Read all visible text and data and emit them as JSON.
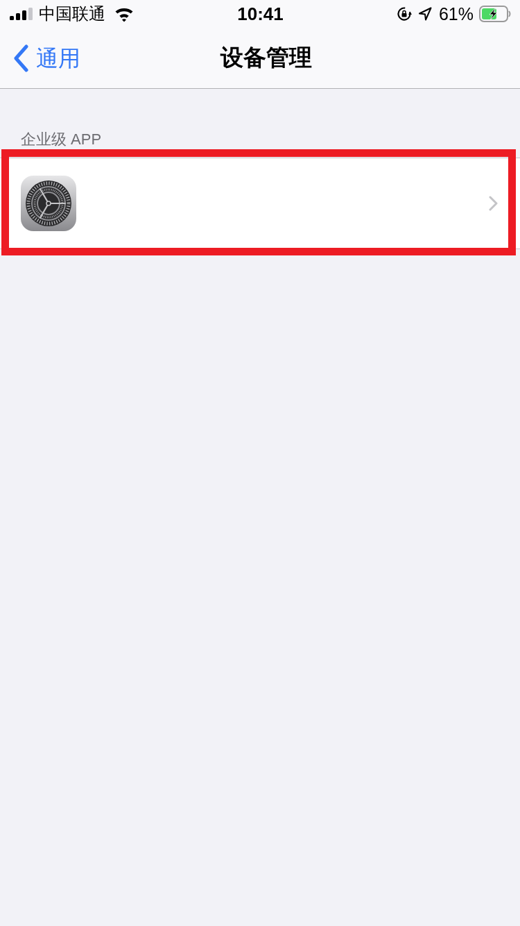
{
  "status_bar": {
    "carrier": "中国联通",
    "time": "10:41",
    "battery_percent": "61%",
    "charging": true
  },
  "nav_bar": {
    "back_label": "通用",
    "title": "设备管理"
  },
  "sections": [
    {
      "header": "企业级 APP",
      "rows": [
        {
          "kind": "app",
          "highlighted": true
        }
      ]
    }
  ]
}
